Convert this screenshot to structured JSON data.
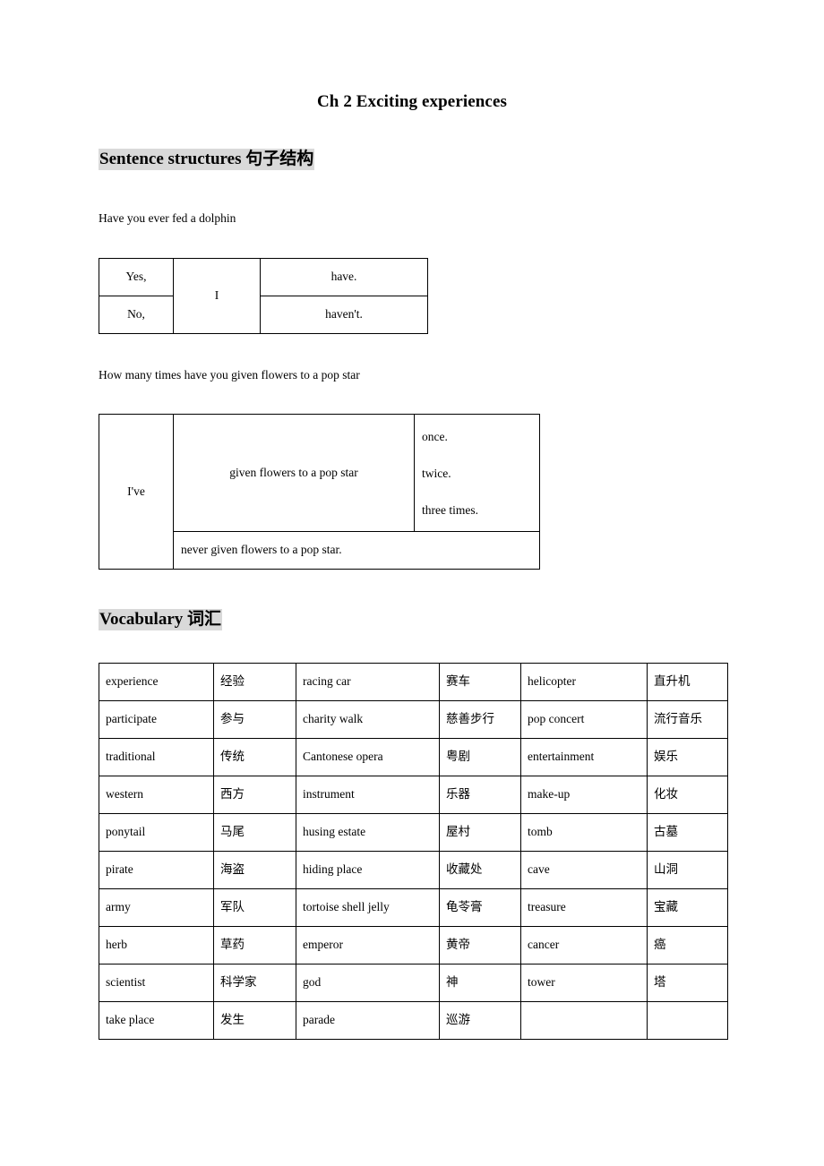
{
  "document": {
    "title": "Ch 2 Exciting experiences"
  },
  "sections": {
    "sentence_structures": {
      "heading": "Sentence structures 句子结构",
      "prompt_1": "Have you ever fed a dolphin",
      "table_1": {
        "rows": [
          {
            "answer": "Yes,",
            "subject": "I",
            "verb": "have."
          },
          {
            "answer": "No,",
            "verb": "haven't."
          }
        ]
      },
      "prompt_2": "How many times have you given flowers to a pop star",
      "table_2": {
        "subject": "I've",
        "phrase": "given flowers to a pop star",
        "times": [
          "once.",
          "twice.",
          "three times."
        ],
        "never": "never given flowers to a pop star."
      }
    },
    "vocabulary": {
      "heading": "Vocabulary 词汇",
      "table": {
        "rows": [
          [
            "experience",
            "经验",
            "racing car",
            "赛车",
            "helicopter",
            "直升机"
          ],
          [
            "participate",
            "参与",
            "charity walk",
            "慈善步行",
            "pop concert",
            "流行音乐"
          ],
          [
            "traditional",
            "传统",
            "Cantonese opera",
            "粤剧",
            "entertainment",
            "娱乐"
          ],
          [
            "western",
            "西方",
            "instrument",
            "乐器",
            "make-up",
            "化妆"
          ],
          [
            "ponytail",
            "马尾",
            "husing estate",
            "屋村",
            "tomb",
            "古墓"
          ],
          [
            "pirate",
            "海盗",
            "hiding place",
            "收藏处",
            "cave",
            "山洞"
          ],
          [
            "army",
            "军队",
            "tortoise shell jelly",
            "龟苓膏",
            "treasure",
            "宝藏"
          ],
          [
            "herb",
            "草药",
            "emperor",
            "黄帝",
            "cancer",
            "癌"
          ],
          [
            "scientist",
            "科学家",
            "god",
            "神",
            "tower",
            "塔"
          ],
          [
            "take place",
            "发生",
            "parade",
            "巡游",
            "",
            ""
          ]
        ]
      }
    }
  },
  "colors": {
    "highlight": "#d9d9d9",
    "text": "#000000",
    "border": "#000000",
    "background": "#ffffff"
  }
}
